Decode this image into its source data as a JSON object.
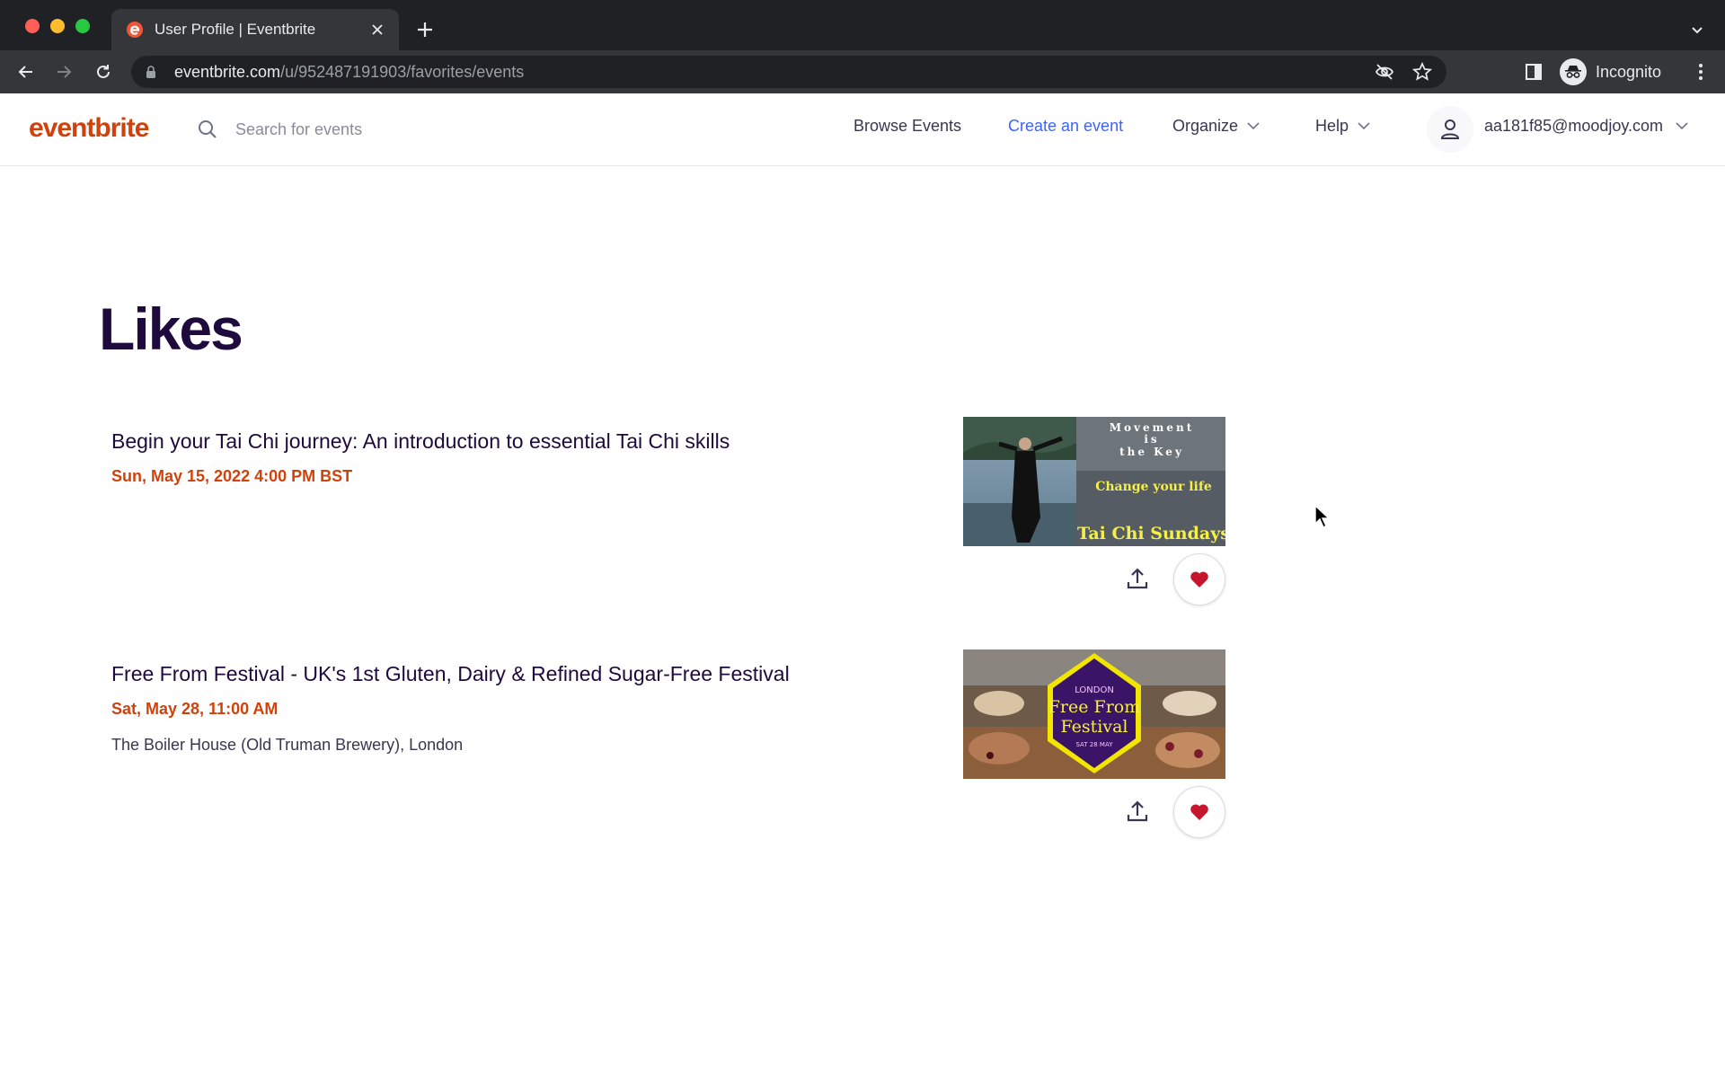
{
  "browser": {
    "tab_title": "User Profile | Eventbrite",
    "url_domain": "eventbrite.com",
    "url_path": "/u/952487191903/favorites/events",
    "profile_label": "Incognito"
  },
  "header": {
    "logo": "eventbrite",
    "search_placeholder": "Search for events",
    "nav": {
      "browse": "Browse Events",
      "create": "Create an event",
      "organize": "Organize",
      "help": "Help"
    },
    "user_email": "aa181f85@moodjoy.com"
  },
  "main": {
    "title": "Likes",
    "events": [
      {
        "title": "Begin your Tai Chi journey: An introduction to essential Tai Chi skills",
        "date": "Sun, May 15, 2022 4:00 PM BST",
        "location": "",
        "image": {
          "line1": "Movement",
          "line2": "is",
          "line3": "the Key",
          "line4": "Change your life",
          "line5": "Tai Chi Sundays"
        }
      },
      {
        "title": "Free From Festival - UK's 1st Gluten, Dairy & Refined Sugar-Free Festival",
        "date": "Sat, May 28, 11:00 AM",
        "location": "The Boiler House (Old Truman Brewery), London",
        "image": {
          "top": "LONDON",
          "line1": "Free From",
          "line2": "Festival",
          "bottom": "SAT 28 MAY"
        }
      }
    ]
  },
  "colors": {
    "brand": "#d1410c",
    "link": "#3d64ff",
    "heading": "#1e0a3c",
    "heart": "#c5162e"
  },
  "icons": [
    "search-icon",
    "chevron-down-icon",
    "user-icon",
    "share-icon",
    "heart-icon"
  ]
}
